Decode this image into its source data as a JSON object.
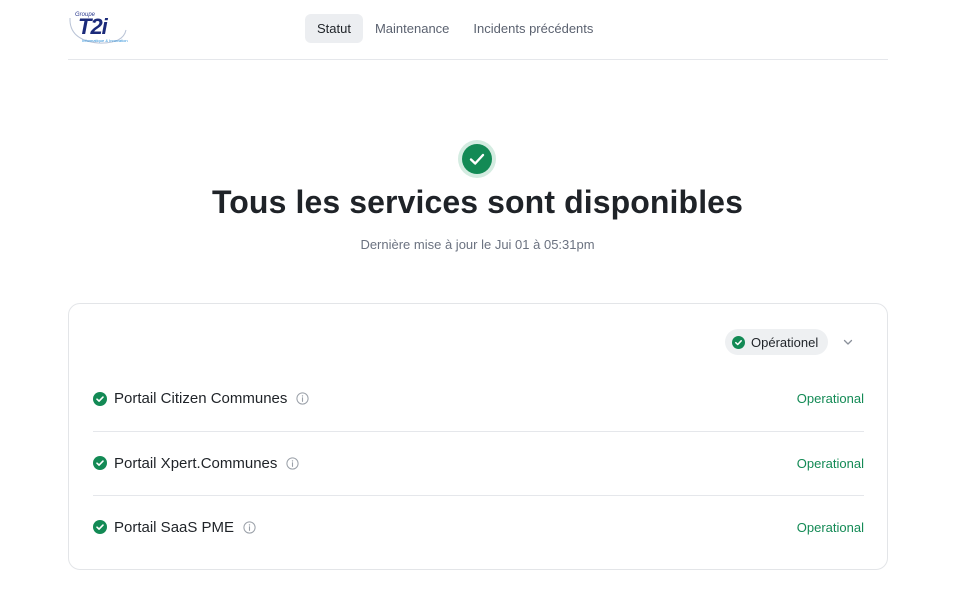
{
  "logo": {
    "small_text": "Groupe",
    "main_text": "T2i",
    "tagline": "Informatique & Innovation"
  },
  "nav": [
    {
      "label": "Statut",
      "active": true
    },
    {
      "label": "Maintenance",
      "active": false
    },
    {
      "label": "Incidents précédents",
      "active": false
    }
  ],
  "hero": {
    "icon": "check-circle-icon",
    "title": "Tous les services sont disponibles",
    "subtitle": "Dernière mise à jour le Jui 01 à 05:31pm"
  },
  "filter": {
    "label": "Opérationel",
    "icon": "check-circle-icon"
  },
  "services": [
    {
      "name": "Portail Citizen Communes",
      "status": "Operational"
    },
    {
      "name": "Portail Xpert.Communes",
      "status": "Operational"
    },
    {
      "name": "Portail SaaS PME",
      "status": "Operational"
    }
  ],
  "colors": {
    "accent_green": "#138a55",
    "muted_text": "#6b7280",
    "border": "#e5e7eb"
  }
}
